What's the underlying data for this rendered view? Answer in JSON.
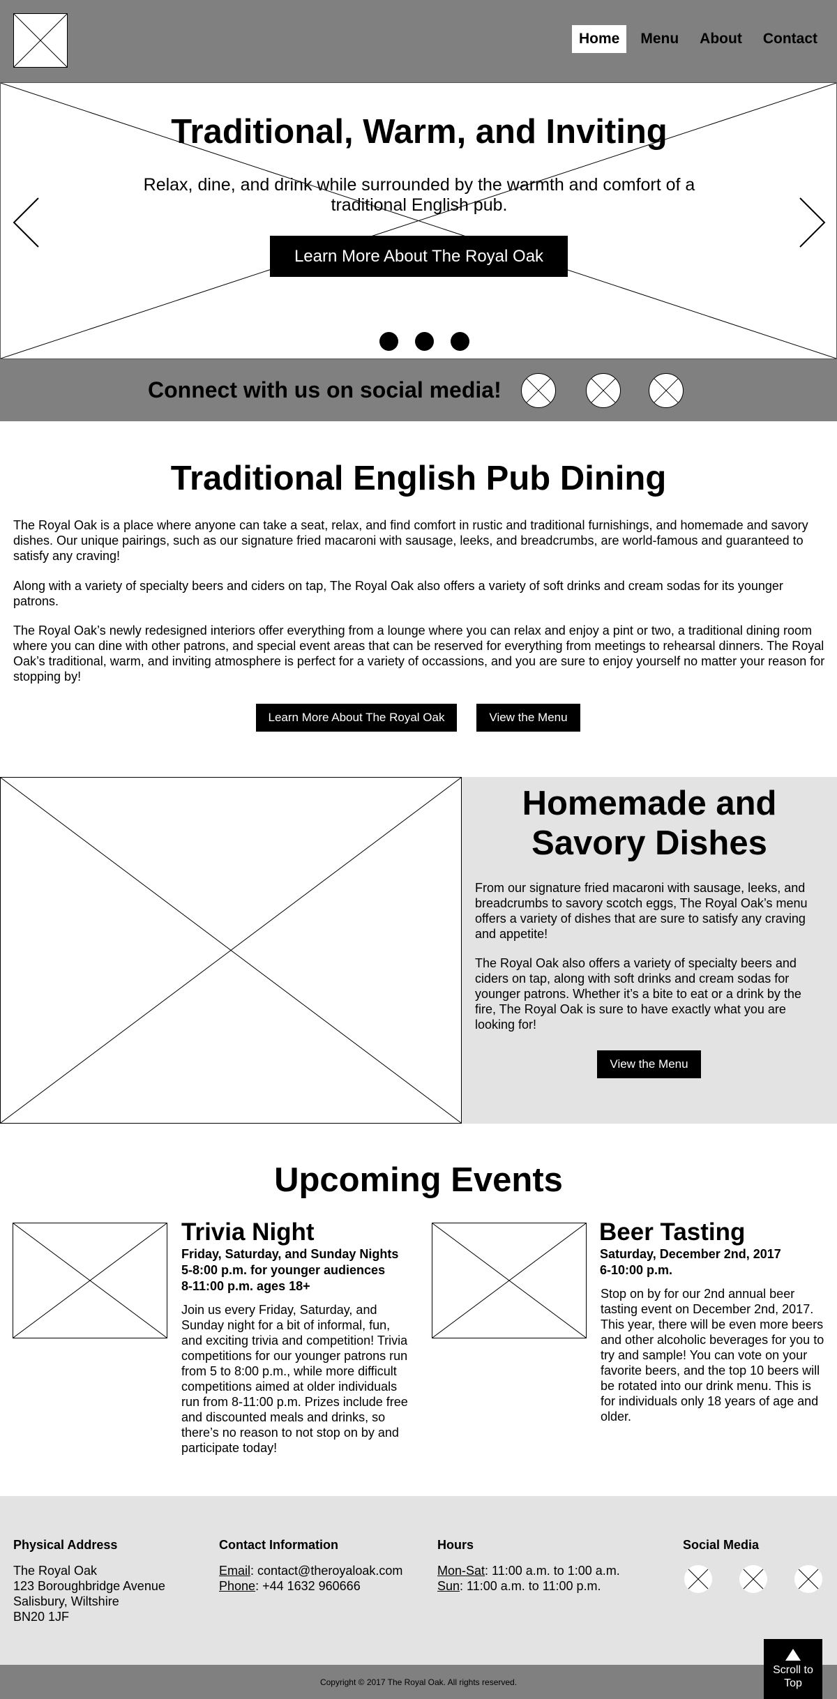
{
  "header": {
    "nav": [
      {
        "label": "Home",
        "active": true
      },
      {
        "label": "Menu",
        "active": false
      },
      {
        "label": "About",
        "active": false
      },
      {
        "label": "Contact",
        "active": false
      }
    ]
  },
  "hero": {
    "title": "Traditional, Warm, and Inviting",
    "subtitle": "Relax, dine, and drink while surrounded by the warmth and comfort of a traditional English pub.",
    "button": "Learn More About The Royal Oak",
    "slide_count": 3
  },
  "social_band": {
    "text": "Connect with us on social media!"
  },
  "dining": {
    "title": "Traditional English Pub Dining",
    "paragraphs": [
      "The Royal Oak is a place where anyone can take a seat, relax, and find comfort in rustic and traditional furnishings, and homemade and savory dishes. Our unique pairings, such as our signature fried macaroni with sausage, leeks, and breadcrumbs, are world-famous and guaranteed to satisfy any craving!",
      "Along with a variety of specialty beers and ciders on tap, The Royal Oak also offers a variety of soft drinks and cream sodas for its younger patrons.",
      "The Royal Oak’s newly redesigned interiors offer everything from a lounge where you can relax and enjoy a pint or two, a traditional dining room where you can dine with other patrons, and special event areas that can be reserved for everything from meetings to rehearsal dinners. The Royal Oak’s traditional, warm, and inviting atmosphere is perfect for a variety of occassions, and you are sure to enjoy yourself no matter your reason for stopping by!"
    ],
    "button_learn": "Learn More About The Royal Oak",
    "button_menu": "View the Menu"
  },
  "homemade": {
    "title_line1": "Homemade and",
    "title_line2": "Savory Dishes",
    "paragraphs": [
      "From our signature fried macaroni with sausage, leeks, and breadcrumbs to savory scotch eggs, The Royal Oak’s menu offers a variety of dishes that are sure to satisfy any craving and appetite!",
      "The Royal Oak also offers a variety of specialty beers and ciders on tap, along with soft drinks and cream sodas for younger patrons. Whether it’s a bite to eat or a drink by the fire, The Royal Oak is sure to have exactly what you are looking for!"
    ],
    "button": "View the Menu"
  },
  "events": {
    "title": "Upcoming Events",
    "items": [
      {
        "title": "Trivia Night",
        "meta": [
          "Friday, Saturday, and Sunday Nights",
          "5-8:00 p.m. for younger audiences",
          "8-11:00 p.m. ages 18+"
        ],
        "description": "Join us every Friday, Saturday, and Sunday night for a bit of informal, fun, and exciting trivia and competition! Trivia competitions for our younger patrons run from 5 to 8:00 p.m., while more difficult competitions aimed at older individuals run from 8-11:00 p.m. Prizes include free and discounted meals and drinks, so there’s no reason to not stop on by and participate today!"
      },
      {
        "title": "Beer Tasting",
        "meta": [
          "Saturday, December 2nd, 2017",
          "6-10:00 p.m."
        ],
        "description": "Stop on by for our 2nd annual beer tasting event on December 2nd, 2017. This year, there will be even more beers and other alcoholic beverages for you to try and sample! You can vote on your favorite beers, and the top 10 beers will be rotated into our drink menu. This is for individuals only 18 years of age and older."
      }
    ]
  },
  "footer": {
    "address_heading": "Physical Address",
    "address_lines": [
      "The Royal Oak",
      "123 Boroughbridge Avenue",
      "Salisbury, Wiltshire",
      "BN20 1JF"
    ],
    "contact_heading": "Contact Information",
    "email_label": "Email",
    "email_value": ": contact@theroyaloak.com",
    "phone_label": "Phone",
    "phone_value": ": +44 1632 960666",
    "hours_heading": "Hours",
    "hours_label_1": "Mon-Sat",
    "hours_value_1": ": 11:00 a.m. to 1:00 a.m.",
    "hours_label_2": "Sun",
    "hours_value_2": ": 11:00 a.m. to 11:00 p.m.",
    "social_heading": "Social Media",
    "copyright": "Copyright © 2017 The Royal Oak. All rights reserved.",
    "scroll_top_line1": "Scroll to",
    "scroll_top_line2": "Top"
  }
}
